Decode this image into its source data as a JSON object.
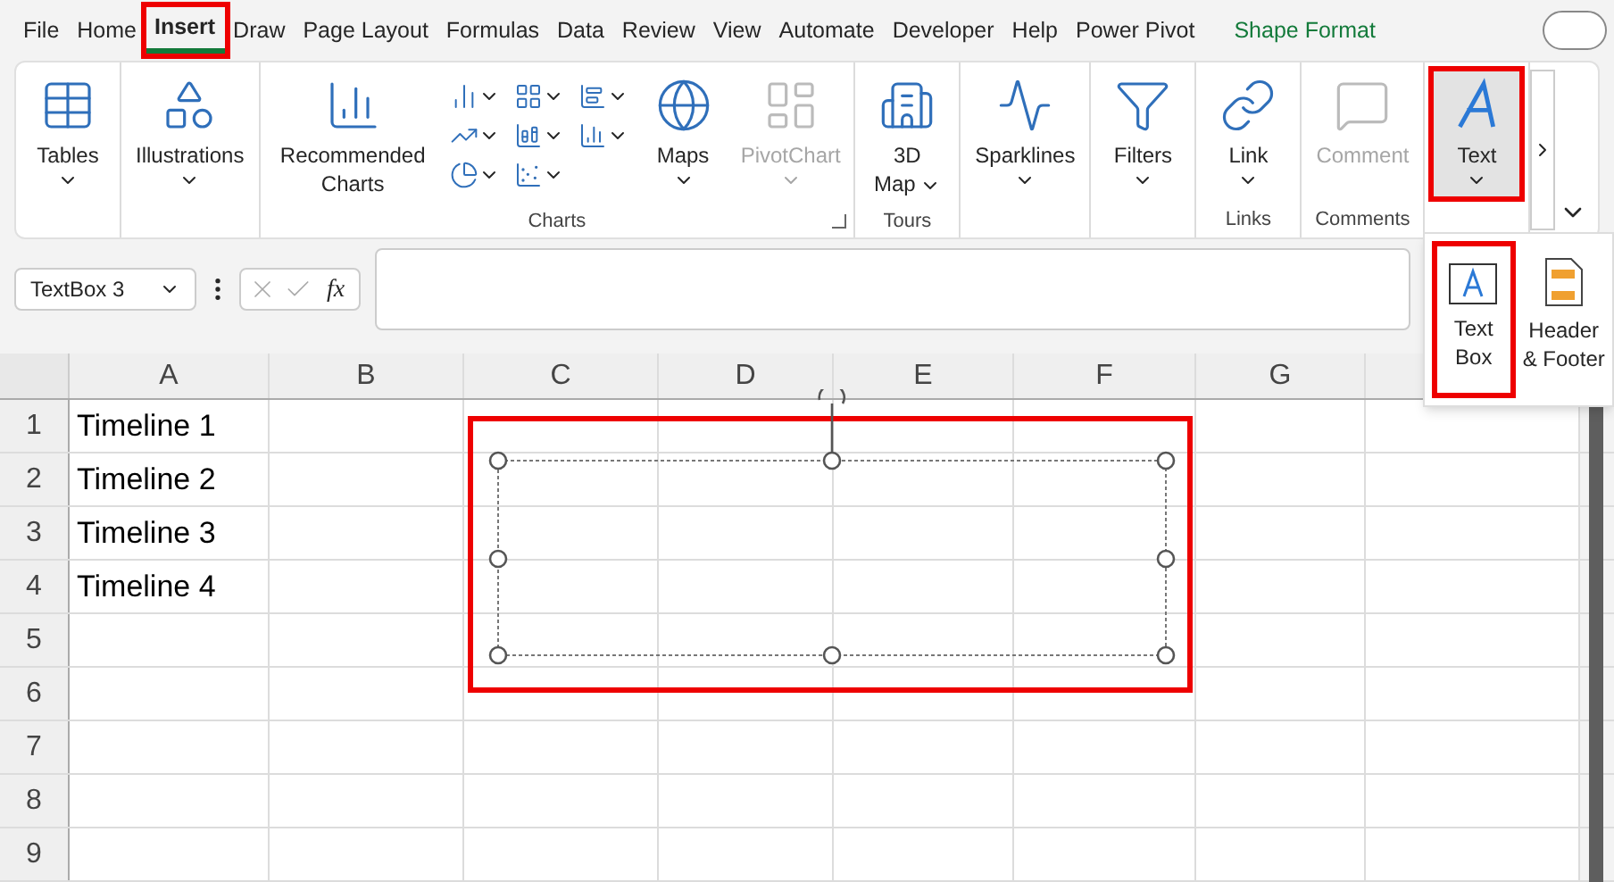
{
  "menu_tabs": [
    {
      "label": "File",
      "selected": false,
      "highlighted": false,
      "kind": "normal"
    },
    {
      "label": "Home",
      "selected": false,
      "highlighted": false,
      "kind": "normal"
    },
    {
      "label": "Insert",
      "selected": true,
      "highlighted": true,
      "kind": "normal"
    },
    {
      "label": "Draw",
      "selected": false,
      "highlighted": false,
      "kind": "normal"
    },
    {
      "label": "Page Layout",
      "selected": false,
      "highlighted": false,
      "kind": "normal"
    },
    {
      "label": "Formulas",
      "selected": false,
      "highlighted": false,
      "kind": "normal"
    },
    {
      "label": "Data",
      "selected": false,
      "highlighted": false,
      "kind": "normal"
    },
    {
      "label": "Review",
      "selected": false,
      "highlighted": false,
      "kind": "normal"
    },
    {
      "label": "View",
      "selected": false,
      "highlighted": false,
      "kind": "normal"
    },
    {
      "label": "Automate",
      "selected": false,
      "highlighted": false,
      "kind": "normal"
    },
    {
      "label": "Developer",
      "selected": false,
      "highlighted": false,
      "kind": "normal"
    },
    {
      "label": "Help",
      "selected": false,
      "highlighted": false,
      "kind": "normal"
    },
    {
      "label": "Power Pivot",
      "selected": false,
      "highlighted": false,
      "kind": "normal"
    },
    {
      "label": "Shape Format",
      "selected": false,
      "highlighted": false,
      "kind": "contextual"
    }
  ],
  "ribbon": {
    "groups": [
      {
        "commands": [
          {
            "kind": "large",
            "label": "Tables",
            "dropdown": true,
            "disabled": false,
            "selected": false,
            "highlighted": false
          }
        ]
      },
      {
        "commands": [
          {
            "kind": "large",
            "label": "Illustrations",
            "dropdown": true,
            "disabled": false,
            "selected": false,
            "highlighted": false
          }
        ]
      },
      {
        "label": "Charts",
        "launcher": true,
        "commands": [
          {
            "kind": "large",
            "label": "Recommended Charts",
            "dropdown": false,
            "disabled": false,
            "selected": false,
            "highlighted": false
          },
          {
            "kind": "small",
            "dropdown": true
          },
          {
            "kind": "small",
            "dropdown": true
          },
          {
            "kind": "small",
            "dropdown": true
          },
          {
            "kind": "small",
            "dropdown": true
          },
          {
            "kind": "small",
            "dropdown": true
          },
          {
            "kind": "small",
            "dropdown": true
          },
          {
            "kind": "small",
            "dropdown": true
          },
          {
            "kind": "small",
            "dropdown": true
          },
          {
            "kind": "large",
            "label": "Maps",
            "dropdown": true,
            "disabled": false,
            "selected": false,
            "highlighted": false
          },
          {
            "kind": "large",
            "label": "PivotChart",
            "dropdown": true,
            "disabled": true,
            "selected": false,
            "highlighted": false
          }
        ]
      },
      {
        "label": "Tours",
        "launcher": false,
        "commands": [
          {
            "kind": "large_wrapped",
            "label": "3D Map",
            "dropdown": true,
            "disabled": false,
            "selected": false,
            "highlighted": false
          }
        ]
      },
      {
        "commands": [
          {
            "kind": "large",
            "label": "Sparklines",
            "dropdown": true,
            "disabled": false,
            "selected": false,
            "highlighted": false
          }
        ]
      },
      {
        "commands": [
          {
            "kind": "large",
            "label": "Filters",
            "dropdown": true,
            "disabled": false,
            "selected": false,
            "highlighted": false
          }
        ]
      },
      {
        "label": "Links",
        "launcher": false,
        "commands": [
          {
            "kind": "large",
            "label": "Link",
            "dropdown": true,
            "disabled": false,
            "selected": false,
            "highlighted": false
          }
        ]
      },
      {
        "label": "Comments",
        "launcher": false,
        "commands": [
          {
            "kind": "large",
            "label": "Comment",
            "dropdown": false,
            "disabled": true,
            "selected": false,
            "highlighted": false
          }
        ]
      },
      {
        "commands": [
          {
            "kind": "large",
            "label": "Text",
            "dropdown": true,
            "disabled": false,
            "selected": true,
            "highlighted": true
          }
        ]
      }
    ]
  },
  "text_menu": [
    {
      "label": "Text Box",
      "highlighted": true
    },
    {
      "label": "Header & Footer",
      "highlighted": false
    }
  ],
  "formula_bar": {
    "name_box": "TextBox 3",
    "function_label": "fx"
  },
  "sheet": {
    "columns": [
      "A",
      "B",
      "C",
      "D",
      "E",
      "F",
      "G"
    ],
    "rows": [
      {
        "header": "1",
        "cells": [
          "Timeline 1"
        ]
      },
      {
        "header": "2",
        "cells": [
          "Timeline 2"
        ]
      },
      {
        "header": "3",
        "cells": [
          "Timeline 3"
        ]
      },
      {
        "header": "4",
        "cells": [
          "Timeline 4"
        ]
      },
      {
        "header": "5",
        "cells": []
      },
      {
        "header": "6",
        "cells": []
      },
      {
        "header": "7",
        "cells": []
      },
      {
        "header": "8",
        "cells": []
      },
      {
        "header": "9",
        "cells": []
      }
    ],
    "shape": {
      "kind": "text_box",
      "selected": true,
      "highlighted": true
    }
  }
}
